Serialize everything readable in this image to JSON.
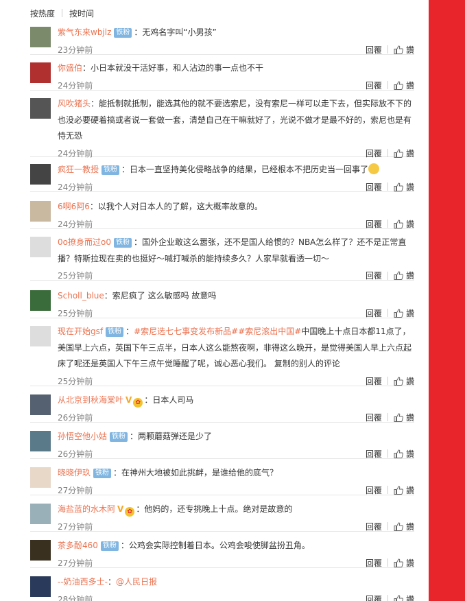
{
  "sort": {
    "by_hot": "按热度",
    "by_time": "按时间"
  },
  "labels": {
    "reply": "回覆",
    "like": "讚",
    "fan_badge": "铁粉"
  },
  "comments": [
    {
      "user": "紫气东来wbjlz",
      "badge": true,
      "text": "：无鸡名字叫“小男孩”",
      "time": "23分钟前",
      "avatar_color": "#7a8a6a"
    },
    {
      "user": "你盛伯",
      "badge": false,
      "text": "：小日本就没干活好事，和人沾边的事一点也不干",
      "time": "24分钟前",
      "avatar_color": "#b03030"
    },
    {
      "user": "风吹猪头",
      "badge": false,
      "text": "：能抵制就抵制，能选其他的就不要选索尼，没有索尼一样可以走下去，但实际放不下的也没必要硬着搞或者说一套做一套，清楚自己在干嘛就好了，光说不做才是最不好的，索尼也是有恃无恐",
      "time": "24分钟前",
      "avatar_color": "#555555"
    },
    {
      "user": "疯狂一教授",
      "badge": true,
      "text": "：日本一直坚持美化侵略战争的结果，已经根本不把历史当一回事了",
      "time": "24分钟前",
      "avatar_color": "#444444"
    },
    {
      "user": "6啊6阿6",
      "badge": false,
      "text": "：以我个人对日本人的了解，这大概率故意的。",
      "time": "24分钟前",
      "avatar_color": "#c9b9a0"
    },
    {
      "user": "0o撩身而过o0",
      "badge": true,
      "text": "：国外企业敢这么嚣张，还不是国人给惯的？NBA怎么样了？还不是正常直播？特斯拉现在卖的也挺好～喊打喊杀的能持续多久？人家早就看透一切～",
      "time": "25分钟前",
      "avatar_color": "#dddddd"
    },
    {
      "user": "Scholl_blue",
      "badge": false,
      "text": "：索尼疯了 这么敏感吗 故意吗",
      "time": "25分钟前",
      "avatar_color": "#3a6b3a"
    },
    {
      "user": "现在开始gsf",
      "badge": true,
      "topic": "#索尼选七七事变发布新品##索尼滚出中国#",
      "text": "中国晚上十点日本都11点了，美国早上六点，英国下午三点半，日本人这么能熬夜啊，非得这么晚开，是觉得美国人早上六点起床了呢还是英国人下午三点午觉睡醒了呢，诚心恶心我们。    复制的别人的评论",
      "time": "25分钟前",
      "avatar_color": "#dddddd"
    },
    {
      "user": "从北京到秋海棠叶",
      "badge": false,
      "vip": "V",
      "emoji_badge": true,
      "text": "：日本人司马",
      "time": "26分钟前",
      "avatar_color": "#556070"
    },
    {
      "user": "孙悟空他小姑",
      "badge": true,
      "text": "：两颗蘑菇弹还是少了",
      "time": "26分钟前",
      "avatar_color": "#5a7a8a"
    },
    {
      "user": "晓晓伊玖",
      "badge": true,
      "text": "：在神州大地被如此挑衅，是谁给他的底气？",
      "time": "27分钟前",
      "avatar_color": "#e8d8c8"
    },
    {
      "user": "海盐蓝的水木阿",
      "badge": false,
      "vip": "V",
      "emoji_badge": true,
      "text": "：他妈的，还专挑晚上十点。绝对是故意的",
      "time": "27分钟前",
      "avatar_color": "#9ab0b8"
    },
    {
      "user": "茶多酚460",
      "badge": true,
      "text": "：公鸡会实际控制着日本。公鸡会唆使脚盆扮丑角。",
      "time": "27分钟前",
      "avatar_color": "#3a3020"
    },
    {
      "user": "--奶油西多士-",
      "badge": false,
      "text": "：",
      "mention": "@人民日报",
      "time": "28分钟前",
      "avatar_color": "#2a3a5a"
    }
  ]
}
